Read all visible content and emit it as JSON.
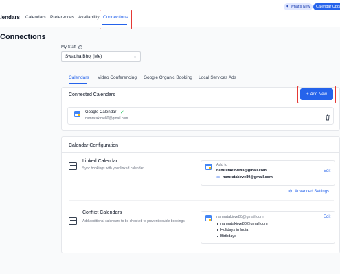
{
  "top_nav": {
    "title": "alendars",
    "tabs": [
      "Calendars",
      "Preferences",
      "Availability",
      "Connections"
    ],
    "active": "Connections",
    "whats_new": "What's New",
    "calendar_update": "Calendar Updat"
  },
  "page": {
    "title": "Connections"
  },
  "staff": {
    "label": "My Staff",
    "selected": "Swadha Bhoj (Me)"
  },
  "subtabs": [
    "Calendars",
    "Video Conferencing",
    "Google Organic Booking",
    "Local Services Ads"
  ],
  "connected": {
    "title": "Connected Calendars",
    "add_new": "Add New",
    "item": {
      "name": "Google Calendar",
      "email": "namratakirve80@gmail.com"
    }
  },
  "config": {
    "title": "Calendar Configuration",
    "linked": {
      "title": "Linked Calendar",
      "desc": "Sync bookings with your linked calendar",
      "add_to": "Add to",
      "add_to_email": "namratakirve80@gmail.com",
      "calendar_email": "namratakirve80@gmail.com",
      "edit": "Edit",
      "advanced": "Advanced Settings"
    },
    "conflict": {
      "title": "Conflict Calendars",
      "desc": "Add additional calendars to be checked to prevent double bookings",
      "account": "namratakirve80@gmail.com",
      "calendars": [
        "namratakirve80@gmail.com",
        "Holidays in India",
        "Birthdays"
      ],
      "edit": "Edit"
    }
  },
  "colors": {
    "accent": "#2563eb",
    "highlight": "#e53935",
    "success": "#22c55e"
  }
}
